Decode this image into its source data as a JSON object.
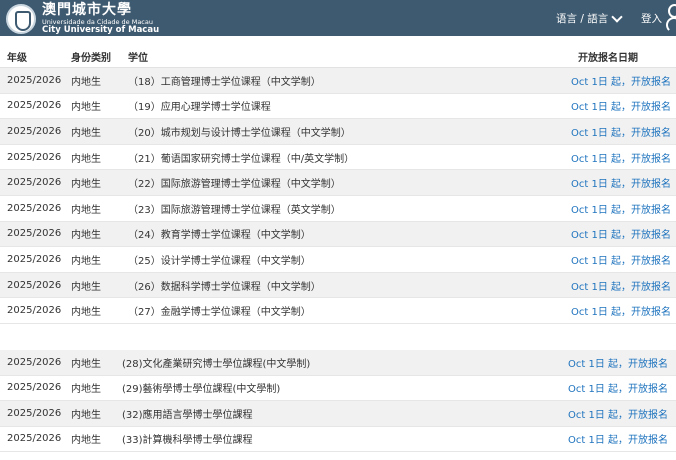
{
  "header": {
    "logo_cn": "澳門城市大學",
    "logo_pt": "Universidade da Cidade de Macau",
    "logo_en": "City University of Macau",
    "language_label": "语言 / 語言",
    "login_label": "登入"
  },
  "table": {
    "columns": [
      "年级",
      "身份类别",
      "学位",
      "开放报名日期"
    ],
    "rows": [
      {
        "year": "2025/2026",
        "identity": "内地生",
        "degree": "（18）工商管理博士学位课程（中文学制）",
        "date": "Oct 1日 起，开放报名"
      },
      {
        "year": "2025/2026",
        "identity": "内地生",
        "degree": "（19）应用心理学博士学位课程",
        "date": "Oct 1日 起，开放报名"
      },
      {
        "year": "2025/2026",
        "identity": "内地生",
        "degree": "（20）城市规划与设计博士学位课程（中文学制）",
        "date": "Oct 1日 起，开放报名"
      },
      {
        "year": "2025/2026",
        "identity": "内地生",
        "degree": "（21）葡语国家研究博士学位课程（中/英文学制）",
        "date": "Oct 1日 起，开放报名"
      },
      {
        "year": "2025/2026",
        "identity": "内地生",
        "degree": "（22）国际旅游管理博士学位课程（中文学制）",
        "date": "Oct 1日 起，开放报名"
      },
      {
        "year": "2025/2026",
        "identity": "内地生",
        "degree": "（23）国际旅游管理博士学位课程（英文学制）",
        "date": "Oct 1日 起，开放报名"
      },
      {
        "year": "2025/2026",
        "identity": "内地生",
        "degree": "（24）教育学博士学位课程（中文学制）",
        "date": "Oct 1日 起，开放报名"
      },
      {
        "year": "2025/2026",
        "identity": "内地生",
        "degree": "（25）设计学博士学位课程（中文学制）",
        "date": "Oct 1日 起，开放报名"
      },
      {
        "year": "2025/2026",
        "identity": "内地生",
        "degree": "（26）数据科学博士学位课程（中文学制）",
        "date": "Oct 1日 起，开放报名"
      },
      {
        "year": "2025/2026",
        "identity": "内地生",
        "degree": "（27）金融学博士学位课程（中文学制）",
        "date": "Oct 1日 起，开放报名"
      }
    ]
  },
  "table2": {
    "rows": [
      {
        "year": "2025/2026",
        "identity": "内地生",
        "degree": "(28)文化產業研究博士學位課程(中文學制)",
        "date": "Oct 1日 起，开放报名"
      },
      {
        "year": "2025/2026",
        "identity": "内地生",
        "degree": "(29)藝術學博士學位課程(中文學制)",
        "date": "Oct 1日 起，开放报名"
      },
      {
        "year": "2025/2026",
        "identity": "内地生",
        "degree": "(32)應用語言學博士學位課程",
        "date": "Oct 1日 起，开放报名"
      },
      {
        "year": "2025/2026",
        "identity": "内地生",
        "degree": "(33)計算機科學博士學位課程",
        "date": "Oct 1日 起，开放报名"
      }
    ]
  }
}
